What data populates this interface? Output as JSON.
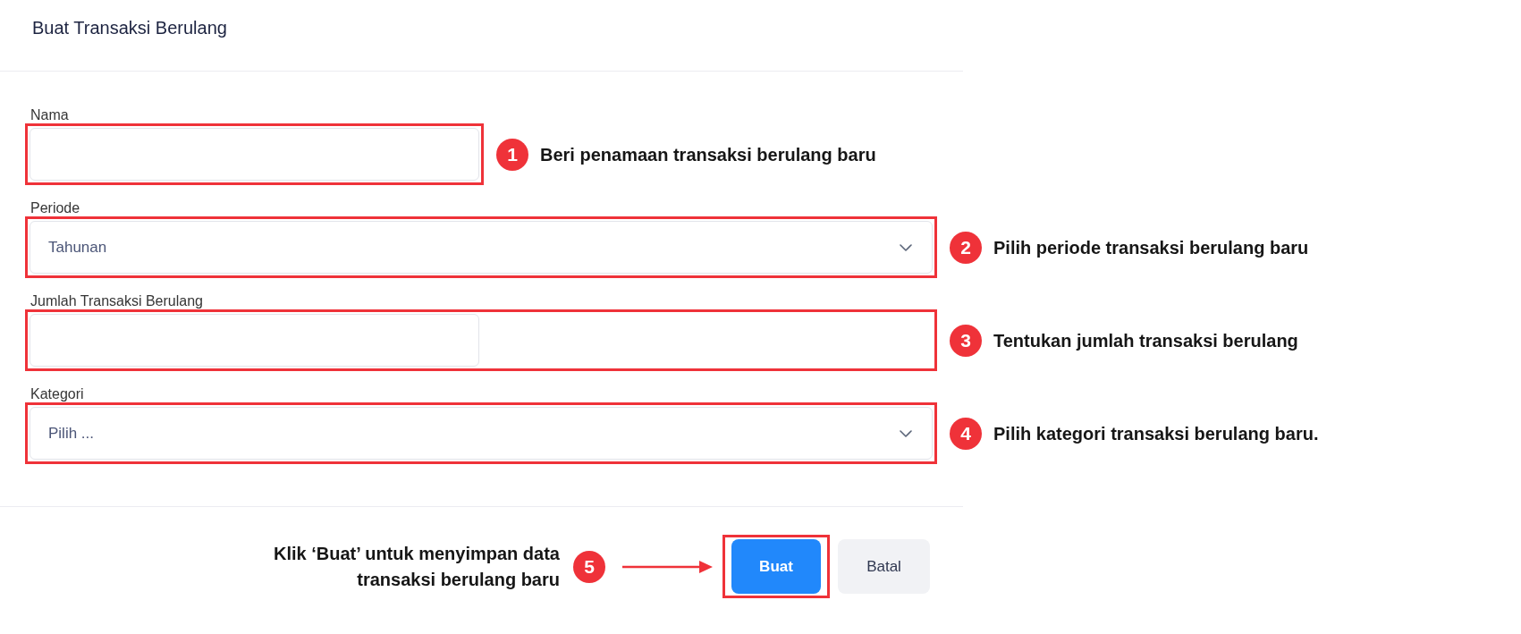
{
  "dialog": {
    "title": "Buat Transaksi Berulang"
  },
  "fields": [
    {
      "kind": "input",
      "label": "Nama",
      "annotation": {
        "number": "1",
        "text": "Beri penamaan transaksi berulang baru",
        "spans_row": false
      }
    },
    {
      "kind": "select",
      "label": "Periode",
      "value": "Tahunan",
      "annotation": {
        "number": "2",
        "text": "Pilih periode transaksi berulang baru",
        "spans_row": true
      }
    },
    {
      "kind": "input",
      "label": "Jumlah Transaksi Berulang",
      "annotation": {
        "number": "3",
        "text": "Tentukan jumlah transaksi berulang",
        "spans_row": true
      }
    },
    {
      "kind": "select",
      "label": "Kategori",
      "placeholder": "Pilih ...",
      "annotation": {
        "number": "4",
        "text": "Pilih kategori transaksi berulang baru.",
        "spans_row": true
      }
    }
  ],
  "footer": {
    "annotation": {
      "number": "5",
      "text": "Klik ‘Buat’ untuk menyimpan data\ntransaksi berulang baru"
    },
    "buttons": [
      {
        "kind": "primary",
        "label": "Buat",
        "highlighted": true
      },
      {
        "kind": "secondary",
        "label": "Batal",
        "highlighted": false
      }
    ]
  }
}
